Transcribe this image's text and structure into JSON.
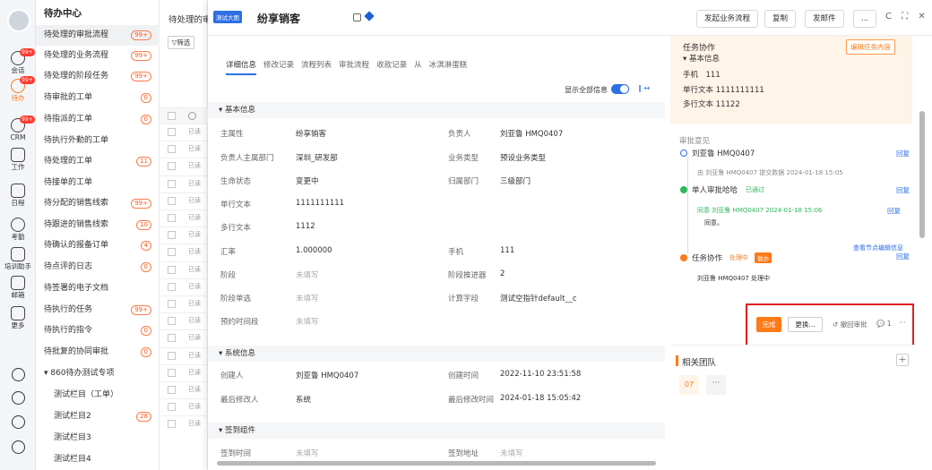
{
  "rail": {
    "items": [
      {
        "label": "会话",
        "badge": "99+"
      },
      {
        "label": "待办",
        "badge": "99+"
      },
      {
        "label": "CRM",
        "badge": "99+"
      },
      {
        "label": "工作",
        "badge": ""
      },
      {
        "label": "日程",
        "badge": ""
      },
      {
        "label": "考勤",
        "badge": ""
      },
      {
        "label": "培训助手",
        "badge": ""
      },
      {
        "label": "邮箱",
        "badge": ""
      },
      {
        "label": "更多",
        "badge": ""
      }
    ]
  },
  "menu": {
    "title": "待办中心",
    "items": [
      {
        "label": "待处理的审批流程",
        "count": "99+"
      },
      {
        "label": "待处理的业务流程",
        "count": "99+"
      },
      {
        "label": "待处理的阶段任务",
        "count": "99+"
      },
      {
        "label": "待审批的工单",
        "count": "0"
      },
      {
        "label": "待指派的工单",
        "count": "0"
      },
      {
        "label": "待执行外勤的工单",
        "count": ""
      },
      {
        "label": "待处理的工单",
        "count": "11"
      },
      {
        "label": "待接单的工单",
        "count": ""
      },
      {
        "label": "待分配的销售线索",
        "count": "99+"
      },
      {
        "label": "待跟进的销售线索",
        "count": "10"
      },
      {
        "label": "待确认的报备订单",
        "count": "4"
      },
      {
        "label": "待点评的日志",
        "count": "0"
      },
      {
        "label": "待签署的电子文档",
        "count": ""
      },
      {
        "label": "待执行的任务",
        "count": "99+"
      },
      {
        "label": "待执行的指令",
        "count": "0"
      },
      {
        "label": "待批复的协同审批",
        "count": "0"
      },
      {
        "label": "▾ 860待办测试专项",
        "count": ""
      },
      {
        "label": "测试栏目（工单）",
        "count": ""
      },
      {
        "label": "测试栏目2",
        "count": "28"
      },
      {
        "label": "测试栏目3",
        "count": ""
      },
      {
        "label": "测试栏目4",
        "count": ""
      }
    ]
  },
  "list": {
    "header": "待处理的审",
    "filter": "▽筛选",
    "rows": [
      "已读",
      "已读",
      "已读",
      "已读",
      "已读",
      "已读",
      "已读",
      "已读",
      "已读",
      "已读",
      "已读",
      "已读",
      "已读",
      "已读",
      "已读",
      "已读",
      "已读",
      "已读"
    ]
  },
  "panel": {
    "tag": "测试大图",
    "title": "纷享销客",
    "buttons": {
      "start": "发起业务流程",
      "copy": "复制",
      "mail": "发邮件",
      "more": "..."
    },
    "win": "C ⛶ ✕",
    "tabs": [
      "详细信息",
      "修改记录",
      "流程列表",
      "审批流程",
      "收款记录",
      "从",
      "冰淇淋蛋糕"
    ],
    "showall": "显示全部信息",
    "colicon": "‖ ↔"
  },
  "sections": {
    "basic": "▾ 基本信息",
    "system": "▾ 系统信息",
    "sign": "▾ 签到组件"
  },
  "fields": {
    "f1k": "主属性",
    "f1v": "纷享销客",
    "f2k": "负责人",
    "f2v": "刘亚鲁 HMQ0407",
    "f3k": "负责人主属部门",
    "f3v": "深圳_研发部",
    "f4k": "业务类型",
    "f4v": "预设业务类型",
    "f5k": "生命状态",
    "f5v": "变更中",
    "f6k": "归属部门",
    "f6v": "三级部门",
    "f7k": "单行文本",
    "f7v": "1111111111",
    "f8k": "多行文本",
    "f8v": "1112",
    "f9k": "汇率",
    "f9v": "1.000000",
    "f10k": "手机",
    "f10v": "111",
    "f11k": "阶段",
    "f11v": "未填写",
    "f12k": "阶段推进器",
    "f12v": "2",
    "f13k": "阶段单选",
    "f13v": "未填写",
    "f14k": "计算字段",
    "f14v": "测试空指针default__c",
    "f15k": "预约时间段",
    "f15v": "未填写",
    "s1k": "创建人",
    "s1v": "刘亚鲁 HMQ0407",
    "s2k": "创建时间",
    "s2v": "2022-11-10 23:51:58",
    "s3k": "最后修改人",
    "s3v": "系统",
    "s4k": "最后修改时间",
    "s4v": "2024-01-18 15:05:42",
    "g1k": "签到时间",
    "g1v": "未填写",
    "g2k": "签到地址",
    "g2v": "未填写"
  },
  "task": {
    "title": "任务协作",
    "edit": "编辑任务内容",
    "info": "▾ 基本信息",
    "phone": "手机　111",
    "single": "单行文本 1111111111",
    "multi": "多行文本 11122"
  },
  "approval": {
    "header": "审批意见",
    "n1": "刘亚鲁 HMQ0407",
    "reply": "回复",
    "n1sub": "由 刘亚鲁 HMQ0407 提交数据 2024-01-18 15:05",
    "n2": "单人审批哈哈",
    "n2status": "已通过",
    "n2sub": "同意 刘亚鲁 HMQ0407  2024-01-18 15:06",
    "n2note": "同意。",
    "viewmore": "查看节点编辑信息",
    "n3": "任务协作",
    "n3status": "处理中",
    "urge": "催办",
    "n3sub": "刘亚鲁 HMQ0407 处理中",
    "done": "完成",
    "change": "更换...",
    "reject": "↺ 撤回审批",
    "chat": "💬 1",
    "dots": "···"
  },
  "team": {
    "title": "相关团队",
    "av": "07",
    "more": "···"
  }
}
